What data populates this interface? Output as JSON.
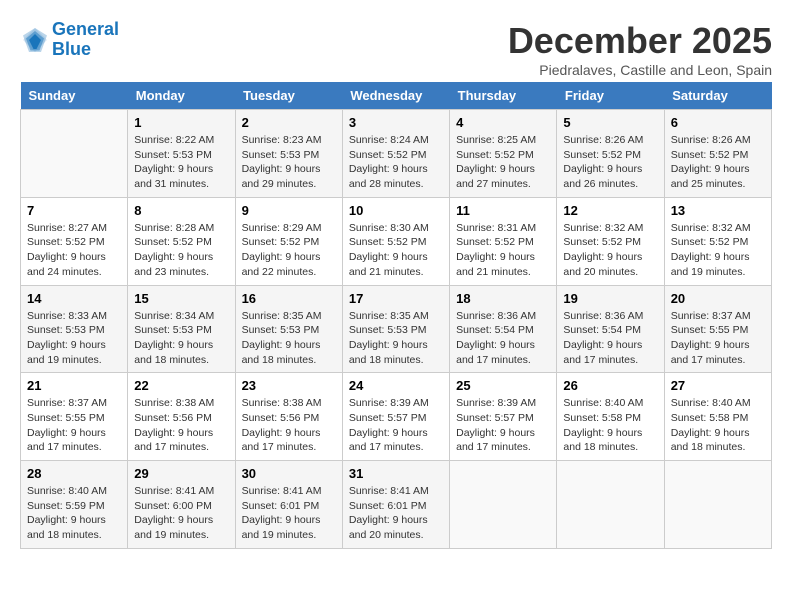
{
  "header": {
    "logo_line1": "General",
    "logo_line2": "Blue",
    "month": "December 2025",
    "location": "Piedralaves, Castille and Leon, Spain"
  },
  "weekdays": [
    "Sunday",
    "Monday",
    "Tuesday",
    "Wednesday",
    "Thursday",
    "Friday",
    "Saturday"
  ],
  "weeks": [
    [
      {
        "day": "",
        "sunrise": "",
        "sunset": "",
        "daylight": ""
      },
      {
        "day": "1",
        "sunrise": "Sunrise: 8:22 AM",
        "sunset": "Sunset: 5:53 PM",
        "daylight": "Daylight: 9 hours and 31 minutes."
      },
      {
        "day": "2",
        "sunrise": "Sunrise: 8:23 AM",
        "sunset": "Sunset: 5:53 PM",
        "daylight": "Daylight: 9 hours and 29 minutes."
      },
      {
        "day": "3",
        "sunrise": "Sunrise: 8:24 AM",
        "sunset": "Sunset: 5:52 PM",
        "daylight": "Daylight: 9 hours and 28 minutes."
      },
      {
        "day": "4",
        "sunrise": "Sunrise: 8:25 AM",
        "sunset": "Sunset: 5:52 PM",
        "daylight": "Daylight: 9 hours and 27 minutes."
      },
      {
        "day": "5",
        "sunrise": "Sunrise: 8:26 AM",
        "sunset": "Sunset: 5:52 PM",
        "daylight": "Daylight: 9 hours and 26 minutes."
      },
      {
        "day": "6",
        "sunrise": "Sunrise: 8:26 AM",
        "sunset": "Sunset: 5:52 PM",
        "daylight": "Daylight: 9 hours and 25 minutes."
      }
    ],
    [
      {
        "day": "7",
        "sunrise": "Sunrise: 8:27 AM",
        "sunset": "Sunset: 5:52 PM",
        "daylight": "Daylight: 9 hours and 24 minutes."
      },
      {
        "day": "8",
        "sunrise": "Sunrise: 8:28 AM",
        "sunset": "Sunset: 5:52 PM",
        "daylight": "Daylight: 9 hours and 23 minutes."
      },
      {
        "day": "9",
        "sunrise": "Sunrise: 8:29 AM",
        "sunset": "Sunset: 5:52 PM",
        "daylight": "Daylight: 9 hours and 22 minutes."
      },
      {
        "day": "10",
        "sunrise": "Sunrise: 8:30 AM",
        "sunset": "Sunset: 5:52 PM",
        "daylight": "Daylight: 9 hours and 21 minutes."
      },
      {
        "day": "11",
        "sunrise": "Sunrise: 8:31 AM",
        "sunset": "Sunset: 5:52 PM",
        "daylight": "Daylight: 9 hours and 21 minutes."
      },
      {
        "day": "12",
        "sunrise": "Sunrise: 8:32 AM",
        "sunset": "Sunset: 5:52 PM",
        "daylight": "Daylight: 9 hours and 20 minutes."
      },
      {
        "day": "13",
        "sunrise": "Sunrise: 8:32 AM",
        "sunset": "Sunset: 5:52 PM",
        "daylight": "Daylight: 9 hours and 19 minutes."
      }
    ],
    [
      {
        "day": "14",
        "sunrise": "Sunrise: 8:33 AM",
        "sunset": "Sunset: 5:53 PM",
        "daylight": "Daylight: 9 hours and 19 minutes."
      },
      {
        "day": "15",
        "sunrise": "Sunrise: 8:34 AM",
        "sunset": "Sunset: 5:53 PM",
        "daylight": "Daylight: 9 hours and 18 minutes."
      },
      {
        "day": "16",
        "sunrise": "Sunrise: 8:35 AM",
        "sunset": "Sunset: 5:53 PM",
        "daylight": "Daylight: 9 hours and 18 minutes."
      },
      {
        "day": "17",
        "sunrise": "Sunrise: 8:35 AM",
        "sunset": "Sunset: 5:53 PM",
        "daylight": "Daylight: 9 hours and 18 minutes."
      },
      {
        "day": "18",
        "sunrise": "Sunrise: 8:36 AM",
        "sunset": "Sunset: 5:54 PM",
        "daylight": "Daylight: 9 hours and 17 minutes."
      },
      {
        "day": "19",
        "sunrise": "Sunrise: 8:36 AM",
        "sunset": "Sunset: 5:54 PM",
        "daylight": "Daylight: 9 hours and 17 minutes."
      },
      {
        "day": "20",
        "sunrise": "Sunrise: 8:37 AM",
        "sunset": "Sunset: 5:55 PM",
        "daylight": "Daylight: 9 hours and 17 minutes."
      }
    ],
    [
      {
        "day": "21",
        "sunrise": "Sunrise: 8:37 AM",
        "sunset": "Sunset: 5:55 PM",
        "daylight": "Daylight: 9 hours and 17 minutes."
      },
      {
        "day": "22",
        "sunrise": "Sunrise: 8:38 AM",
        "sunset": "Sunset: 5:56 PM",
        "daylight": "Daylight: 9 hours and 17 minutes."
      },
      {
        "day": "23",
        "sunrise": "Sunrise: 8:38 AM",
        "sunset": "Sunset: 5:56 PM",
        "daylight": "Daylight: 9 hours and 17 minutes."
      },
      {
        "day": "24",
        "sunrise": "Sunrise: 8:39 AM",
        "sunset": "Sunset: 5:57 PM",
        "daylight": "Daylight: 9 hours and 17 minutes."
      },
      {
        "day": "25",
        "sunrise": "Sunrise: 8:39 AM",
        "sunset": "Sunset: 5:57 PM",
        "daylight": "Daylight: 9 hours and 17 minutes."
      },
      {
        "day": "26",
        "sunrise": "Sunrise: 8:40 AM",
        "sunset": "Sunset: 5:58 PM",
        "daylight": "Daylight: 9 hours and 18 minutes."
      },
      {
        "day": "27",
        "sunrise": "Sunrise: 8:40 AM",
        "sunset": "Sunset: 5:58 PM",
        "daylight": "Daylight: 9 hours and 18 minutes."
      }
    ],
    [
      {
        "day": "28",
        "sunrise": "Sunrise: 8:40 AM",
        "sunset": "Sunset: 5:59 PM",
        "daylight": "Daylight: 9 hours and 18 minutes."
      },
      {
        "day": "29",
        "sunrise": "Sunrise: 8:41 AM",
        "sunset": "Sunset: 6:00 PM",
        "daylight": "Daylight: 9 hours and 19 minutes."
      },
      {
        "day": "30",
        "sunrise": "Sunrise: 8:41 AM",
        "sunset": "Sunset: 6:01 PM",
        "daylight": "Daylight: 9 hours and 19 minutes."
      },
      {
        "day": "31",
        "sunrise": "Sunrise: 8:41 AM",
        "sunset": "Sunset: 6:01 PM",
        "daylight": "Daylight: 9 hours and 20 minutes."
      },
      {
        "day": "",
        "sunrise": "",
        "sunset": "",
        "daylight": ""
      },
      {
        "day": "",
        "sunrise": "",
        "sunset": "",
        "daylight": ""
      },
      {
        "day": "",
        "sunrise": "",
        "sunset": "",
        "daylight": ""
      }
    ]
  ]
}
